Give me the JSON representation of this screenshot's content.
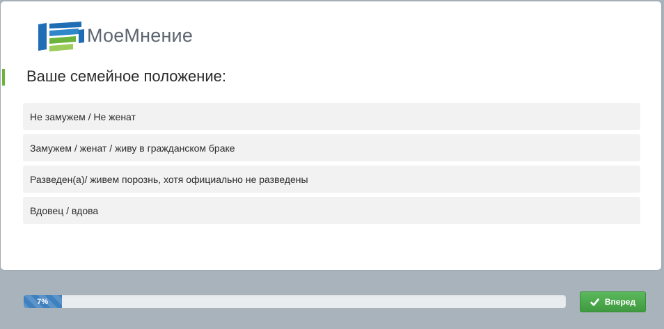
{
  "brand": {
    "name": "МоеМнение",
    "colors": {
      "logo_blue": "#1f6db5",
      "logo_green": "#6cb33e",
      "text_gray": "#5d6670"
    }
  },
  "question": {
    "title": "Ваше семейное положение:",
    "accent_color": "#6cb33e"
  },
  "options": [
    {
      "label": "Не замужем / Не женат"
    },
    {
      "label": "Замужем / женат / живу в гражданском браке"
    },
    {
      "label": "Разведен(а)/ живем порознь, хотя официально не разведены"
    },
    {
      "label": "Вдовец / вдова"
    }
  ],
  "footer": {
    "progress": {
      "percent": 7,
      "label": "7%",
      "color": "#3f80bf"
    },
    "next_button": {
      "label": "Вперед",
      "icon": "check-icon",
      "color": "#5cb85c"
    }
  }
}
